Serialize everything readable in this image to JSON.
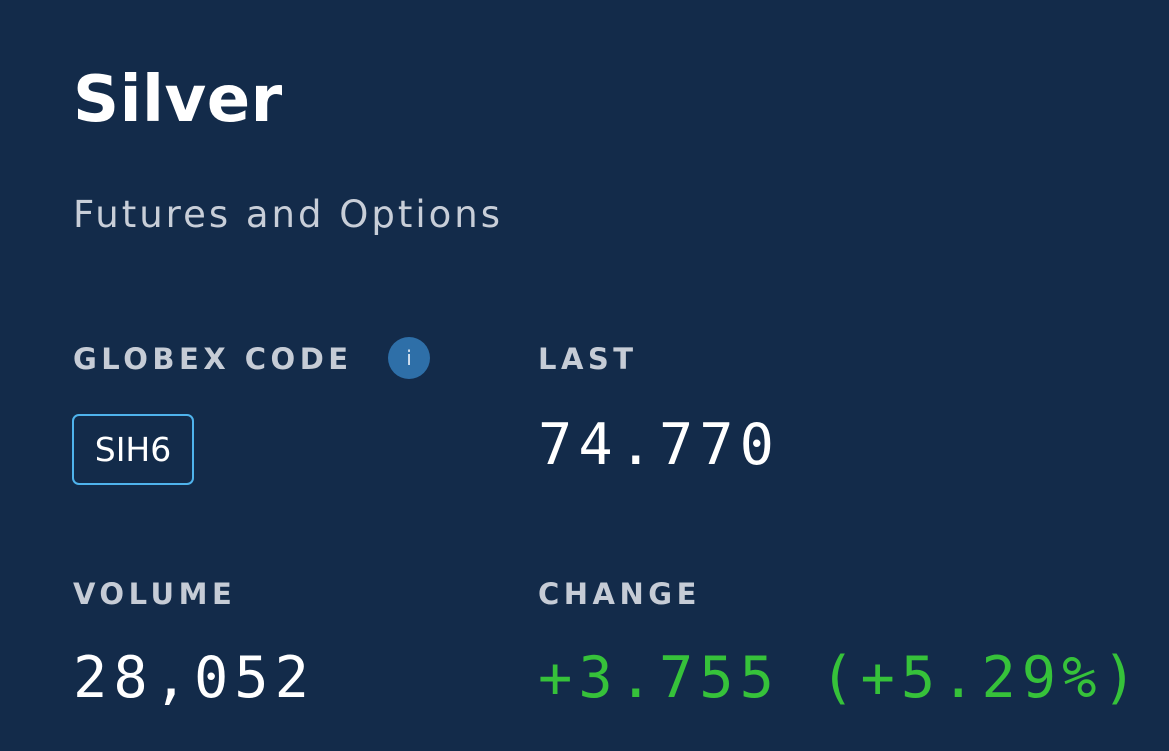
{
  "product": {
    "title": "Silver",
    "subtitle": "Futures and Options"
  },
  "quote": {
    "globex_code_label": "GLOBEX CODE",
    "globex_code": "SIH6",
    "info_icon": "info-icon",
    "last_label": "LAST",
    "last_value": "74.770",
    "volume_label": "VOLUME",
    "volume_value": "28,052",
    "change_label": "CHANGE",
    "change_value": "+3.755 (+5.29%)"
  },
  "colors": {
    "background": "#132b4a",
    "accent": "#4fb3ec",
    "positive_change": "#36c23a",
    "info_icon": "#2e6fa8"
  }
}
